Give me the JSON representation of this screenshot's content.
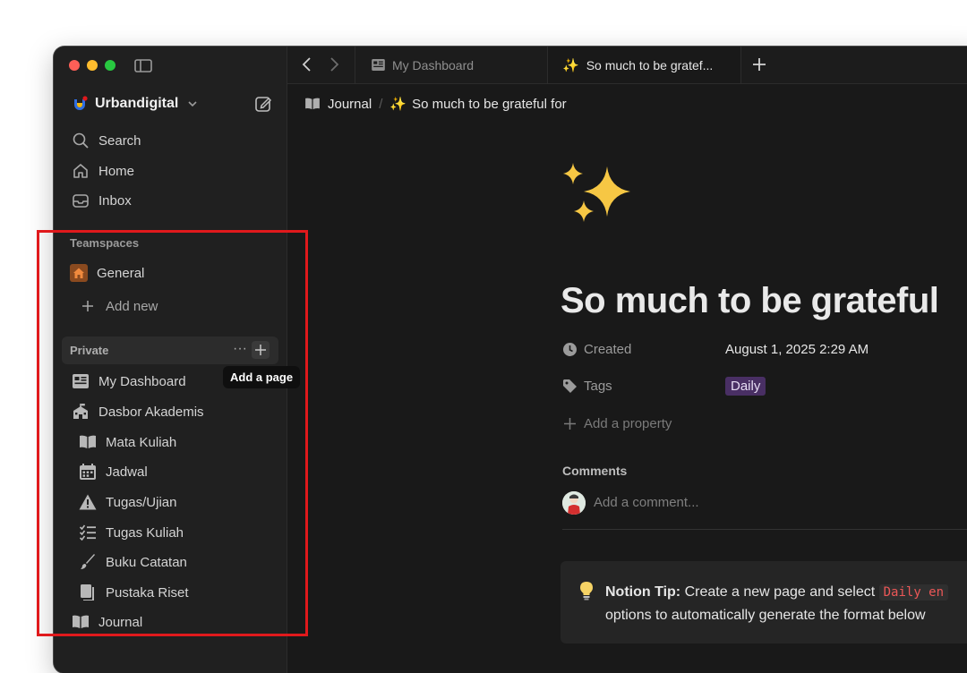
{
  "workspace": {
    "name": "Urbandigital"
  },
  "nav": [
    {
      "label": "Search",
      "icon": "search-icon"
    },
    {
      "label": "Home",
      "icon": "home-icon"
    },
    {
      "label": "Inbox",
      "icon": "inbox-icon"
    }
  ],
  "teamspaces": {
    "label": "Teamspaces",
    "items": [
      {
        "label": "General",
        "icon": "house-icon"
      }
    ],
    "add_new": "Add new"
  },
  "private": {
    "label": "Private",
    "tooltip": "Add a page",
    "items": [
      {
        "label": "My Dashboard",
        "icon": "dashboard-icon"
      },
      {
        "label": "Dasbor Akademis",
        "icon": "school-icon"
      },
      {
        "label": "Mata Kuliah",
        "icon": "book-icon"
      },
      {
        "label": "Jadwal",
        "icon": "calendar-icon"
      },
      {
        "label": "Tugas/Ujian",
        "icon": "warning-icon"
      },
      {
        "label": "Tugas Kuliah",
        "icon": "checklist-icon"
      },
      {
        "label": "Buku Catatan",
        "icon": "brush-icon"
      },
      {
        "label": "Pustaka Riset",
        "icon": "documents-icon"
      },
      {
        "label": "Journal",
        "icon": "book-icon"
      }
    ]
  },
  "tabs": [
    {
      "label": "My Dashboard",
      "icon": "dashboard-icon",
      "active": false
    },
    {
      "label": "So much to be gratef...",
      "icon": "sparkles-icon",
      "active": true
    }
  ],
  "breadcrumb": [
    {
      "label": "Journal",
      "icon": "book-icon"
    },
    {
      "label": "So much to be grateful for",
      "icon": "sparkles-icon"
    }
  ],
  "page": {
    "icon": "sparkles-icon",
    "title": "So much to be grateful",
    "properties": [
      {
        "name": "Created",
        "icon": "clock-icon",
        "value": "August 1, 2025 2:29 AM"
      },
      {
        "name": "Tags",
        "icon": "tag-icon",
        "value": "Daily"
      }
    ],
    "add_property": "Add a property",
    "comments_label": "Comments",
    "comment_placeholder": "Add a comment...",
    "tip": {
      "bold": "Notion Tip:",
      "text_before": " Create a new page and select ",
      "code": "Daily en",
      "line2": "options to automatically generate the format below"
    }
  },
  "colors": {
    "background": "#191919",
    "sidebar": "#202020",
    "tag_bg": "#492f64",
    "highlight_border": "#e0191c",
    "code_text": "#eb5757"
  }
}
